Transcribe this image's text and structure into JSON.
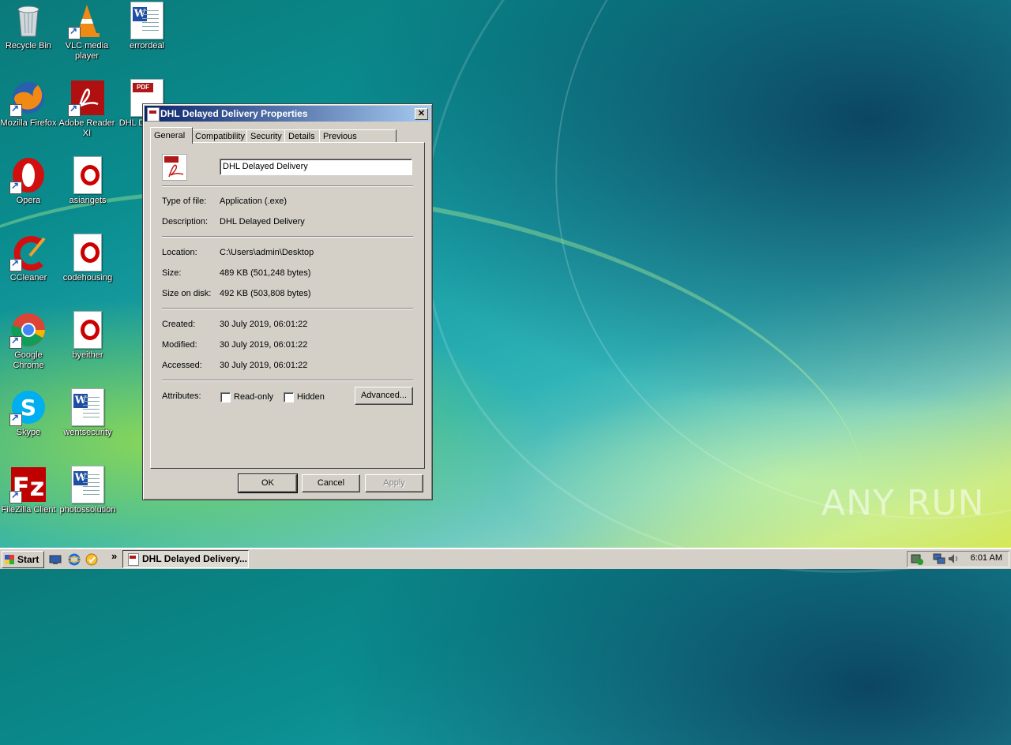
{
  "desktop": {
    "icons": [
      {
        "label": "Recycle Bin"
      },
      {
        "label": "VLC media player"
      },
      {
        "label": "errordeal"
      },
      {
        "label": "Mozilla Firefox"
      },
      {
        "label": "Adobe Reader XI"
      },
      {
        "label": "DHL D... Del..."
      },
      {
        "label": "Opera"
      },
      {
        "label": "asiangets"
      },
      {
        "label": "CCleaner"
      },
      {
        "label": "codehousing"
      },
      {
        "label": "Google Chrome"
      },
      {
        "label": "byeither"
      },
      {
        "label": "Skype"
      },
      {
        "label": "wentsecurity"
      },
      {
        "label": "FileZilla Client"
      },
      {
        "label": "photossolution"
      }
    ],
    "watermark": "ANY RUN"
  },
  "dialog": {
    "title": "DHL Delayed Delivery Properties",
    "close_label": "✕",
    "tabs": [
      "General",
      "Compatibility",
      "Security",
      "Details",
      "Previous Versions"
    ],
    "active_tab": "General",
    "file_name": "DHL Delayed Delivery",
    "type_label": "Type of file:",
    "type_value": "Application (.exe)",
    "description_label": "Description:",
    "description_value": "DHL Delayed Delivery",
    "location_label": "Location:",
    "location_value": "C:\\Users\\admin\\Desktop",
    "size_label": "Size:",
    "size_value": "489 KB (501,248 bytes)",
    "size_on_disk_label": "Size on disk:",
    "size_on_disk_value": "492 KB (503,808 bytes)",
    "created_label": "Created:",
    "created_value": "30 July 2019, 06:01:22",
    "modified_label": "Modified:",
    "modified_value": "30 July 2019, 06:01:22",
    "accessed_label": "Accessed:",
    "accessed_value": "30 July 2019, 06:01:22",
    "attributes_label": "Attributes:",
    "readonly_label": "Read-only",
    "hidden_label": "Hidden",
    "advanced_label": "Advanced...",
    "ok_label": "OK",
    "cancel_label": "Cancel",
    "apply_label": "Apply"
  },
  "taskbar": {
    "start_label": "Start",
    "overflow_label": "»",
    "task_label": "DHL Delayed Delivery...",
    "clock": "6:01 AM"
  },
  "colors": {
    "titlebar_start": "#0a246a",
    "titlebar_end": "#a6caf0",
    "face": "#d4d0c8"
  }
}
